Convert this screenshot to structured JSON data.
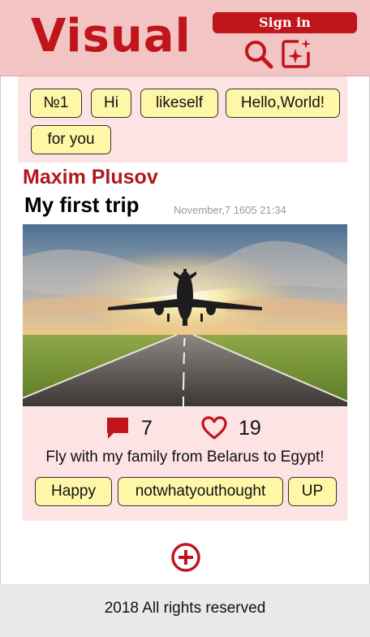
{
  "header": {
    "logo": "Visual",
    "signin_label": "Sign in",
    "search_icon": "search-icon",
    "create_icon": "create-post-icon"
  },
  "tags": [
    "№1",
    "Hi",
    "likeself",
    "Hello,World!",
    "for you"
  ],
  "post": {
    "author": "Maxim Plusov",
    "title": "My first trip",
    "date": "November,7 1605 21:34",
    "image": "airplane taking off from runway at sunset",
    "comments": "7",
    "likes": "19",
    "caption": "Fly with my family from Belarus to Egypt!",
    "tags": [
      "Happy",
      "notwhatyouthought",
      "UP"
    ]
  },
  "add_icon": "add-circle-icon",
  "footer": "2018  All rights reserved",
  "colors": {
    "accent": "#c0151b",
    "header_bg": "#f2c4c4",
    "panel_bg": "#fde3e3",
    "tag_bg": "#fff7a8",
    "footer_bg": "#e9e9e9"
  }
}
